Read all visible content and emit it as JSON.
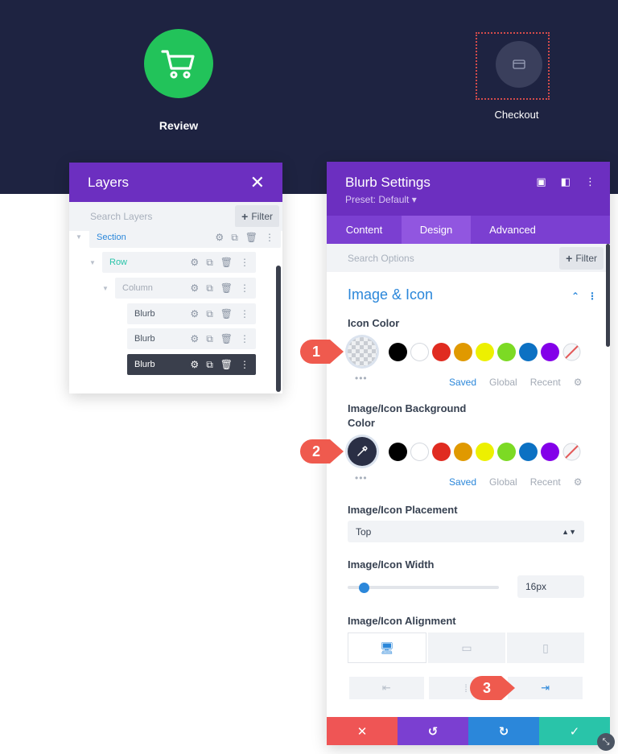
{
  "canvas": {
    "review_label": "Review",
    "checkout_label": "Checkout",
    "review_icon": "shopping-cart-icon",
    "checkout_icon": "credit-card-icon",
    "colors": {
      "band": "#1e2341",
      "review_circle": "#22c35a",
      "checkout_circle": "#3a3f5c"
    }
  },
  "layers": {
    "title": "Layers",
    "search_placeholder": "Search Layers",
    "filter_label": "Filter",
    "items": [
      {
        "label": "Section",
        "type": "section"
      },
      {
        "label": "Row",
        "type": "row"
      },
      {
        "label": "Column",
        "type": "column"
      },
      {
        "label": "Blurb",
        "type": "module"
      },
      {
        "label": "Blurb",
        "type": "module"
      },
      {
        "label": "Blurb",
        "type": "module",
        "selected": true
      }
    ]
  },
  "settings": {
    "title": "Blurb Settings",
    "preset": "Preset: Default ▾",
    "tabs": [
      {
        "label": "Content"
      },
      {
        "label": "Design",
        "active": true
      },
      {
        "label": "Advanced"
      }
    ],
    "search_placeholder": "Search Options",
    "filter_label": "Filter",
    "section_title": "Image & Icon",
    "icon_color": {
      "label": "Icon Color",
      "palette_tabs": [
        "Saved",
        "Global",
        "Recent"
      ]
    },
    "bg_color": {
      "label_line1": "Image/Icon Background",
      "label_line2": "Color",
      "palette_tabs": [
        "Saved",
        "Global",
        "Recent"
      ]
    },
    "swatches": [
      "#000000",
      "#ffffff",
      "#e02b20",
      "#e09900",
      "#edf000",
      "#7cda24",
      "#0c71c3",
      "#8300e9"
    ],
    "placement": {
      "label": "Image/Icon Placement",
      "value": "Top"
    },
    "width": {
      "label": "Image/Icon Width",
      "value": "16px",
      "slider_fraction": 0.07
    },
    "alignment": {
      "label": "Image/Icon Alignment"
    },
    "accent": "#2b87da"
  },
  "badges": [
    "1",
    "2",
    "3"
  ],
  "bottom_bar_colors": [
    "#ef5555",
    "#7b3fd1",
    "#2b87da",
    "#29c4a9"
  ]
}
